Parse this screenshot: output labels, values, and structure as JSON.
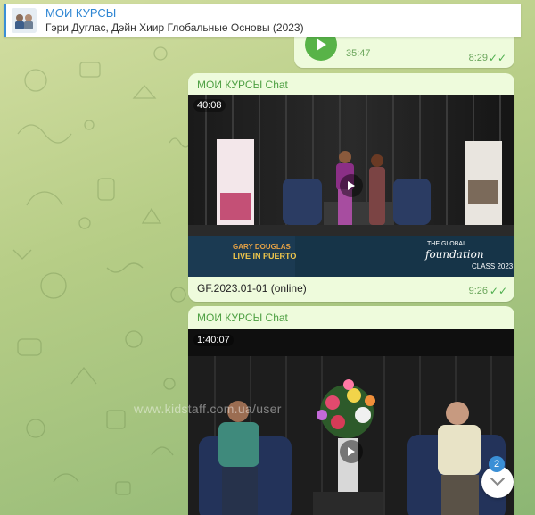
{
  "header": {
    "title": "МОИ КУРСЫ",
    "subtitle": "Гэри Дуглас, Дэйн Хиир  Глобальные Основы (2023)"
  },
  "messages": [
    {
      "type": "audio",
      "duration": "35:47",
      "time": "8:29",
      "status": "read"
    },
    {
      "type": "video",
      "sender": "МОИ КУРСЫ Chat",
      "duration": "40:08",
      "caption": "GF.2023.01-01 (online)",
      "time": "9:26",
      "status": "read",
      "banner_left": "GARY DOUGLAS",
      "banner_left2": "LIVE IN PUERTO",
      "banner_right": "THE GLOBAL",
      "banner_right2": "foundation",
      "banner_right3": "CLASS 2023"
    },
    {
      "type": "video",
      "sender": "МОИ КУРСЫ Chat",
      "duration": "1:40:07"
    }
  ],
  "watermark": "www.kidstaff.com.ua/user",
  "scroll_badge": "2",
  "colors": {
    "accent": "#3a8fd6",
    "bubble": "#eefbdc",
    "sender": "#4ea043"
  }
}
